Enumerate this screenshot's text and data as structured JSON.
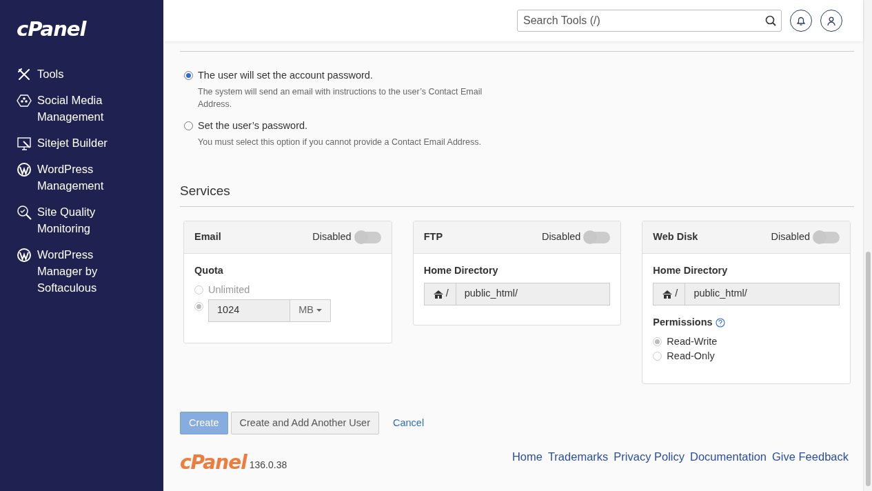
{
  "sidebar": {
    "logo": "cPanel",
    "items": [
      {
        "label": "Tools",
        "kind": "tools"
      },
      {
        "label": "Social Media Management",
        "kind": "social"
      },
      {
        "label": "Sitejet Builder",
        "kind": "monitor"
      },
      {
        "label": "WordPress Management",
        "kind": "wp"
      },
      {
        "label": "Site Quality Monitoring",
        "kind": "magnifier"
      },
      {
        "label": "WordPress Manager by Softaculous",
        "kind": "wp"
      }
    ]
  },
  "header": {
    "search": {
      "placeholder": "Search Tools (/)"
    }
  },
  "security": {
    "options": [
      {
        "label": "The user will set the account password.",
        "help": "The system will send an email with instructions to the user’s Contact Email Address.",
        "selected": true
      },
      {
        "label": "Set the user’s password.",
        "help": "You must select this option if you cannot provide a Contact Email Address.",
        "selected": false
      }
    ]
  },
  "services": {
    "title": "Services",
    "cards": [
      {
        "title": "Email",
        "status": "Disabled",
        "on": false,
        "sections": [
          {
            "kind": "quota",
            "label": "Quota",
            "options": [
              {
                "kind": "plain",
                "label": "Unlimited",
                "selected": false
              },
              {
                "kind": "input",
                "value": "1024",
                "unit": "MB",
                "selected": true
              }
            ]
          }
        ]
      },
      {
        "title": "FTP",
        "status": "Disabled",
        "on": false,
        "sections": [
          {
            "kind": "home",
            "label": "Home Directory",
            "prefix": "/",
            "value": "public_html/"
          }
        ]
      },
      {
        "title": "Web Disk",
        "status": "Disabled",
        "on": false,
        "sections": [
          {
            "kind": "home",
            "label": "Home Directory",
            "prefix": "/",
            "value": "public_html/"
          },
          {
            "kind": "permissions",
            "label": "Permissions",
            "options": [
              {
                "label": "Read-Write",
                "selected": true
              },
              {
                "label": "Read-Only",
                "selected": false
              }
            ]
          }
        ]
      }
    ]
  },
  "actions": [
    {
      "kind": "primary",
      "label": "Create",
      "disabled": true
    },
    {
      "kind": "secondary",
      "label": "Create and Add Another User"
    },
    {
      "kind": "link",
      "label": "Cancel"
    }
  ],
  "footer": {
    "logo": "cPanel",
    "version": "136.0.38",
    "links": [
      "Home",
      "Trademarks",
      "Privacy Policy",
      "Documentation",
      "Give Feedback"
    ]
  }
}
